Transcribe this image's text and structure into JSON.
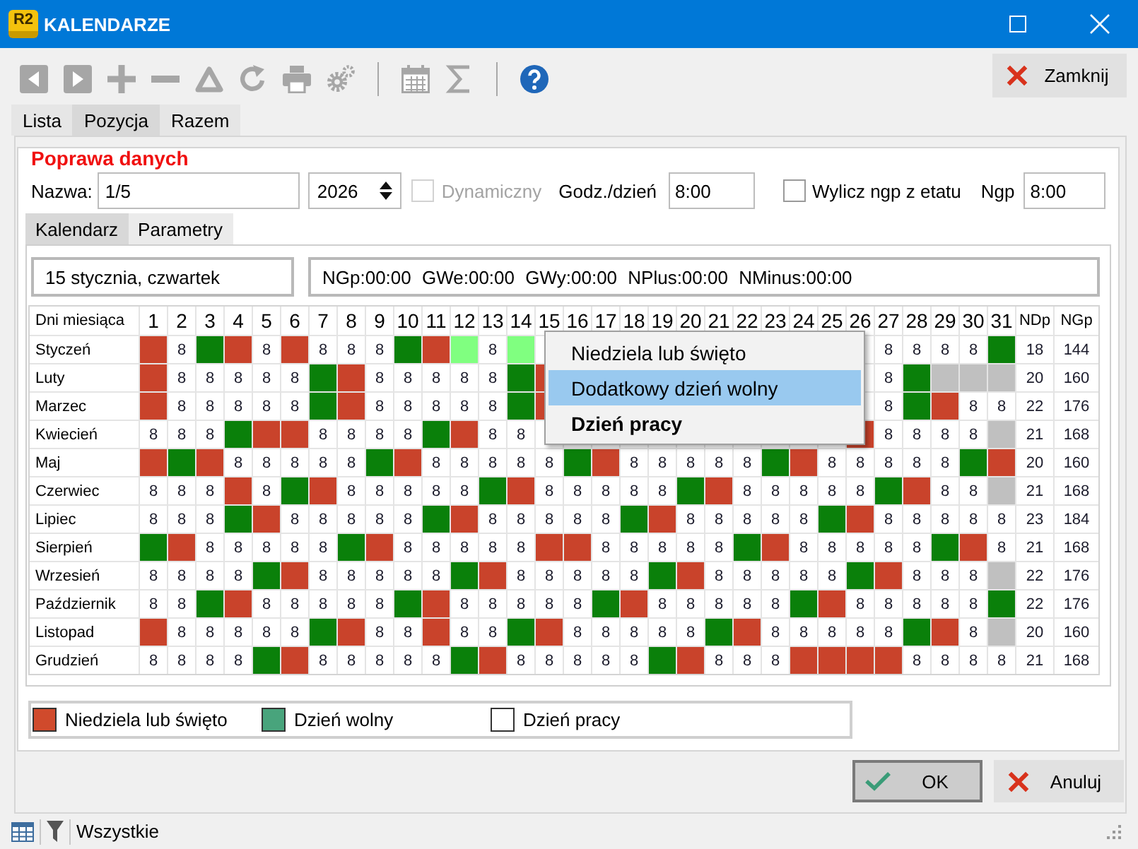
{
  "window": {
    "logo": "R2",
    "title": "KALENDARZE"
  },
  "toolbar": [
    {
      "kind": "back",
      "disabled": true
    },
    {
      "kind": "forward",
      "disabled": true
    },
    {
      "kind": "add",
      "disabled": true
    },
    {
      "kind": "remove",
      "disabled": true
    },
    {
      "kind": "delta",
      "disabled": true
    },
    {
      "kind": "refresh",
      "disabled": true
    },
    {
      "kind": "print",
      "disabled": true
    },
    {
      "kind": "gears",
      "disabled": true
    },
    {
      "kind": "separator"
    },
    {
      "kind": "calendar",
      "disabled": true
    },
    {
      "kind": "sigma",
      "disabled": true
    },
    {
      "kind": "separator"
    },
    {
      "kind": "help",
      "disabled": false
    }
  ],
  "close_button": {
    "label": "Zamknij"
  },
  "tabs": [
    {
      "label": "Lista",
      "selected": false
    },
    {
      "label": "Pozycja",
      "selected": true
    },
    {
      "label": "Razem",
      "selected": false
    }
  ],
  "panel": {
    "title": "Poprawa danych",
    "name": {
      "label": "Nazwa:",
      "value": "1/5"
    },
    "year": {
      "value": "2026"
    },
    "dynamic": {
      "label": "Dynamiczny",
      "checked": false,
      "disabled": true
    },
    "hours_per_day": {
      "label": "Godz./dzień",
      "value": "8:00"
    },
    "compute_ngp": {
      "label": "Wylicz ngp z etatu",
      "checked": false,
      "disabled": false
    },
    "ngp": {
      "label": "Ngp",
      "value": "8:00"
    },
    "subtabs": [
      {
        "label": "Kalendarz",
        "selected": true
      },
      {
        "label": "Parametry",
        "selected": false
      }
    ],
    "date_info": "15 stycznia, czwartek",
    "summary": "NGp:00:00 GWe:00:00 GWy:00:00 NPlus:00:00 NMinus:00:00",
    "calendar": {
      "corner": "Dni miesiąca",
      "columns": [
        "1",
        "2",
        "3",
        "4",
        "5",
        "6",
        "7",
        "8",
        "9",
        "10",
        "11",
        "12",
        "13",
        "14",
        "15",
        "16",
        "17",
        "18",
        "19",
        "20",
        "21",
        "22",
        "23",
        "24",
        "25",
        "26",
        "27",
        "28",
        "29",
        "30",
        "31",
        "NDp",
        "NGp"
      ],
      "rows": [
        {
          "month": "Styczeń",
          "cells": [
            {
              "kind": "holiday"
            },
            {
              "kind": "work",
              "text": "8"
            },
            {
              "kind": "free"
            },
            {
              "kind": "holiday"
            },
            {
              "kind": "work",
              "text": "8"
            },
            {
              "kind": "holiday"
            },
            {
              "kind": "work",
              "text": "8"
            },
            {
              "kind": "work",
              "text": "8"
            },
            {
              "kind": "work",
              "text": "8"
            },
            {
              "kind": "free"
            },
            {
              "kind": "holiday"
            },
            {
              "kind": "extra"
            },
            {
              "kind": "work",
              "text": "8"
            },
            {
              "kind": "extra"
            },
            {
              "kind": "work"
            },
            {
              "kind": "covered"
            },
            {
              "kind": "covered"
            },
            {
              "kind": "covered"
            },
            {
              "kind": "covered"
            },
            {
              "kind": "covered"
            },
            {
              "kind": "covered"
            },
            {
              "kind": "covered"
            },
            {
              "kind": "covered"
            },
            {
              "kind": "covered"
            },
            {
              "kind": "covered"
            },
            {
              "kind": "work"
            },
            {
              "kind": "work",
              "text": "8"
            },
            {
              "kind": "work",
              "text": "8"
            },
            {
              "kind": "work",
              "text": "8"
            },
            {
              "kind": "work",
              "text": "8"
            },
            {
              "kind": "free"
            },
            {
              "kind": "total",
              "text": "18"
            },
            {
              "kind": "total",
              "text": "144"
            }
          ]
        },
        {
          "month": "Luty",
          "cells": [
            {
              "kind": "holiday"
            },
            {
              "kind": "work",
              "text": "8"
            },
            {
              "kind": "work",
              "text": "8"
            },
            {
              "kind": "work",
              "text": "8"
            },
            {
              "kind": "work",
              "text": "8"
            },
            {
              "kind": "work",
              "text": "8"
            },
            {
              "kind": "free"
            },
            {
              "kind": "holiday"
            },
            {
              "kind": "work",
              "text": "8"
            },
            {
              "kind": "work",
              "text": "8"
            },
            {
              "kind": "work",
              "text": "8"
            },
            {
              "kind": "work",
              "text": "8"
            },
            {
              "kind": "work",
              "text": "8"
            },
            {
              "kind": "free"
            },
            {
              "kind": "holiday"
            },
            {
              "kind": "covered"
            },
            {
              "kind": "covered"
            },
            {
              "kind": "covered"
            },
            {
              "kind": "covered"
            },
            {
              "kind": "covered"
            },
            {
              "kind": "covered"
            },
            {
              "kind": "covered"
            },
            {
              "kind": "covered"
            },
            {
              "kind": "covered"
            },
            {
              "kind": "covered"
            },
            {
              "kind": "work"
            },
            {
              "kind": "work",
              "text": "8"
            },
            {
              "kind": "free"
            },
            {
              "kind": "empty"
            },
            {
              "kind": "empty"
            },
            {
              "kind": "empty"
            },
            {
              "kind": "total",
              "text": "20"
            },
            {
              "kind": "total",
              "text": "160"
            }
          ]
        },
        {
          "month": "Marzec",
          "cells": [
            {
              "kind": "holiday"
            },
            {
              "kind": "work",
              "text": "8"
            },
            {
              "kind": "work",
              "text": "8"
            },
            {
              "kind": "work",
              "text": "8"
            },
            {
              "kind": "work",
              "text": "8"
            },
            {
              "kind": "work",
              "text": "8"
            },
            {
              "kind": "free"
            },
            {
              "kind": "holiday"
            },
            {
              "kind": "work",
              "text": "8"
            },
            {
              "kind": "work",
              "text": "8"
            },
            {
              "kind": "work",
              "text": "8"
            },
            {
              "kind": "work",
              "text": "8"
            },
            {
              "kind": "work",
              "text": "8"
            },
            {
              "kind": "free"
            },
            {
              "kind": "holiday"
            },
            {
              "kind": "covered"
            },
            {
              "kind": "covered"
            },
            {
              "kind": "covered"
            },
            {
              "kind": "covered"
            },
            {
              "kind": "covered"
            },
            {
              "kind": "covered"
            },
            {
              "kind": "covered"
            },
            {
              "kind": "covered"
            },
            {
              "kind": "covered"
            },
            {
              "kind": "covered"
            },
            {
              "kind": "work"
            },
            {
              "kind": "work",
              "text": "8"
            },
            {
              "kind": "free"
            },
            {
              "kind": "holiday"
            },
            {
              "kind": "work",
              "text": "8"
            },
            {
              "kind": "work",
              "text": "8"
            },
            {
              "kind": "total",
              "text": "22"
            },
            {
              "kind": "total",
              "text": "176"
            }
          ]
        },
        {
          "month": "Kwiecień",
          "cells": [
            {
              "kind": "work",
              "text": "8"
            },
            {
              "kind": "work",
              "text": "8"
            },
            {
              "kind": "work",
              "text": "8"
            },
            {
              "kind": "free"
            },
            {
              "kind": "holiday"
            },
            {
              "kind": "holiday"
            },
            {
              "kind": "work",
              "text": "8"
            },
            {
              "kind": "work",
              "text": "8"
            },
            {
              "kind": "work",
              "text": "8"
            },
            {
              "kind": "work",
              "text": "8"
            },
            {
              "kind": "free"
            },
            {
              "kind": "holiday"
            },
            {
              "kind": "work",
              "text": "8"
            },
            {
              "kind": "work",
              "text": "8"
            },
            {
              "kind": "work"
            },
            {
              "kind": "covered"
            },
            {
              "kind": "covered"
            },
            {
              "kind": "covered"
            },
            {
              "kind": "covered"
            },
            {
              "kind": "covered"
            },
            {
              "kind": "covered"
            },
            {
              "kind": "covered"
            },
            {
              "kind": "covered"
            },
            {
              "kind": "covered"
            },
            {
              "kind": "covered"
            },
            {
              "kind": "holiday"
            },
            {
              "kind": "work",
              "text": "8"
            },
            {
              "kind": "work",
              "text": "8"
            },
            {
              "kind": "work",
              "text": "8"
            },
            {
              "kind": "work",
              "text": "8"
            },
            {
              "kind": "empty"
            },
            {
              "kind": "total",
              "text": "21"
            },
            {
              "kind": "total",
              "text": "168"
            }
          ]
        },
        {
          "month": "Maj",
          "cells": [
            {
              "kind": "holiday"
            },
            {
              "kind": "free"
            },
            {
              "kind": "holiday"
            },
            {
              "kind": "work",
              "text": "8"
            },
            {
              "kind": "work",
              "text": "8"
            },
            {
              "kind": "work",
              "text": "8"
            },
            {
              "kind": "work",
              "text": "8"
            },
            {
              "kind": "work",
              "text": "8"
            },
            {
              "kind": "free"
            },
            {
              "kind": "holiday"
            },
            {
              "kind": "work",
              "text": "8"
            },
            {
              "kind": "work",
              "text": "8"
            },
            {
              "kind": "work",
              "text": "8"
            },
            {
              "kind": "work",
              "text": "8"
            },
            {
              "kind": "work",
              "text": "8"
            },
            {
              "kind": "free"
            },
            {
              "kind": "holiday"
            },
            {
              "kind": "work",
              "text": "8"
            },
            {
              "kind": "work",
              "text": "8"
            },
            {
              "kind": "work",
              "text": "8"
            },
            {
              "kind": "work",
              "text": "8"
            },
            {
              "kind": "work",
              "text": "8"
            },
            {
              "kind": "free"
            },
            {
              "kind": "holiday"
            },
            {
              "kind": "work",
              "text": "8"
            },
            {
              "kind": "work",
              "text": "8"
            },
            {
              "kind": "work",
              "text": "8"
            },
            {
              "kind": "work",
              "text": "8"
            },
            {
              "kind": "work",
              "text": "8"
            },
            {
              "kind": "free"
            },
            {
              "kind": "holiday"
            },
            {
              "kind": "total",
              "text": "20"
            },
            {
              "kind": "total",
              "text": "160"
            }
          ]
        },
        {
          "month": "Czerwiec",
          "cells": [
            {
              "kind": "work",
              "text": "8"
            },
            {
              "kind": "work",
              "text": "8"
            },
            {
              "kind": "work",
              "text": "8"
            },
            {
              "kind": "holiday"
            },
            {
              "kind": "work",
              "text": "8"
            },
            {
              "kind": "free"
            },
            {
              "kind": "holiday"
            },
            {
              "kind": "work",
              "text": "8"
            },
            {
              "kind": "work",
              "text": "8"
            },
            {
              "kind": "work",
              "text": "8"
            },
            {
              "kind": "work",
              "text": "8"
            },
            {
              "kind": "work",
              "text": "8"
            },
            {
              "kind": "free"
            },
            {
              "kind": "holiday"
            },
            {
              "kind": "work",
              "text": "8"
            },
            {
              "kind": "work",
              "text": "8"
            },
            {
              "kind": "work",
              "text": "8"
            },
            {
              "kind": "work",
              "text": "8"
            },
            {
              "kind": "work",
              "text": "8"
            },
            {
              "kind": "free"
            },
            {
              "kind": "holiday"
            },
            {
              "kind": "work",
              "text": "8"
            },
            {
              "kind": "work",
              "text": "8"
            },
            {
              "kind": "work",
              "text": "8"
            },
            {
              "kind": "work",
              "text": "8"
            },
            {
              "kind": "work",
              "text": "8"
            },
            {
              "kind": "free"
            },
            {
              "kind": "holiday"
            },
            {
              "kind": "work",
              "text": "8"
            },
            {
              "kind": "work",
              "text": "8"
            },
            {
              "kind": "empty"
            },
            {
              "kind": "total",
              "text": "21"
            },
            {
              "kind": "total",
              "text": "168"
            }
          ]
        },
        {
          "month": "Lipiec",
          "cells": [
            {
              "kind": "work",
              "text": "8"
            },
            {
              "kind": "work",
              "text": "8"
            },
            {
              "kind": "work",
              "text": "8"
            },
            {
              "kind": "free"
            },
            {
              "kind": "holiday"
            },
            {
              "kind": "work",
              "text": "8"
            },
            {
              "kind": "work",
              "text": "8"
            },
            {
              "kind": "work",
              "text": "8"
            },
            {
              "kind": "work",
              "text": "8"
            },
            {
              "kind": "work",
              "text": "8"
            },
            {
              "kind": "free"
            },
            {
              "kind": "holiday"
            },
            {
              "kind": "work",
              "text": "8"
            },
            {
              "kind": "work",
              "text": "8"
            },
            {
              "kind": "work",
              "text": "8"
            },
            {
              "kind": "work",
              "text": "8"
            },
            {
              "kind": "work",
              "text": "8"
            },
            {
              "kind": "free"
            },
            {
              "kind": "holiday"
            },
            {
              "kind": "work",
              "text": "8"
            },
            {
              "kind": "work",
              "text": "8"
            },
            {
              "kind": "work",
              "text": "8"
            },
            {
              "kind": "work",
              "text": "8"
            },
            {
              "kind": "work",
              "text": "8"
            },
            {
              "kind": "free"
            },
            {
              "kind": "holiday"
            },
            {
              "kind": "work",
              "text": "8"
            },
            {
              "kind": "work",
              "text": "8"
            },
            {
              "kind": "work",
              "text": "8"
            },
            {
              "kind": "work",
              "text": "8"
            },
            {
              "kind": "work",
              "text": "8"
            },
            {
              "kind": "total",
              "text": "23"
            },
            {
              "kind": "total",
              "text": "184"
            }
          ]
        },
        {
          "month": "Sierpień",
          "cells": [
            {
              "kind": "free"
            },
            {
              "kind": "holiday"
            },
            {
              "kind": "work",
              "text": "8"
            },
            {
              "kind": "work",
              "text": "8"
            },
            {
              "kind": "work",
              "text": "8"
            },
            {
              "kind": "work",
              "text": "8"
            },
            {
              "kind": "work",
              "text": "8"
            },
            {
              "kind": "free"
            },
            {
              "kind": "holiday"
            },
            {
              "kind": "work",
              "text": "8"
            },
            {
              "kind": "work",
              "text": "8"
            },
            {
              "kind": "work",
              "text": "8"
            },
            {
              "kind": "work",
              "text": "8"
            },
            {
              "kind": "work",
              "text": "8"
            },
            {
              "kind": "holiday"
            },
            {
              "kind": "holiday"
            },
            {
              "kind": "work",
              "text": "8"
            },
            {
              "kind": "work",
              "text": "8"
            },
            {
              "kind": "work",
              "text": "8"
            },
            {
              "kind": "work",
              "text": "8"
            },
            {
              "kind": "work",
              "text": "8"
            },
            {
              "kind": "free"
            },
            {
              "kind": "holiday"
            },
            {
              "kind": "work",
              "text": "8"
            },
            {
              "kind": "work",
              "text": "8"
            },
            {
              "kind": "work",
              "text": "8"
            },
            {
              "kind": "work",
              "text": "8"
            },
            {
              "kind": "work",
              "text": "8"
            },
            {
              "kind": "free"
            },
            {
              "kind": "holiday"
            },
            {
              "kind": "work",
              "text": "8"
            },
            {
              "kind": "total",
              "text": "21"
            },
            {
              "kind": "total",
              "text": "168"
            }
          ]
        },
        {
          "month": "Wrzesień",
          "cells": [
            {
              "kind": "work",
              "text": "8"
            },
            {
              "kind": "work",
              "text": "8"
            },
            {
              "kind": "work",
              "text": "8"
            },
            {
              "kind": "work",
              "text": "8"
            },
            {
              "kind": "free"
            },
            {
              "kind": "holiday"
            },
            {
              "kind": "work",
              "text": "8"
            },
            {
              "kind": "work",
              "text": "8"
            },
            {
              "kind": "work",
              "text": "8"
            },
            {
              "kind": "work",
              "text": "8"
            },
            {
              "kind": "work",
              "text": "8"
            },
            {
              "kind": "free"
            },
            {
              "kind": "holiday"
            },
            {
              "kind": "work",
              "text": "8"
            },
            {
              "kind": "work",
              "text": "8"
            },
            {
              "kind": "work",
              "text": "8"
            },
            {
              "kind": "work",
              "text": "8"
            },
            {
              "kind": "work",
              "text": "8"
            },
            {
              "kind": "free"
            },
            {
              "kind": "holiday"
            },
            {
              "kind": "work",
              "text": "8"
            },
            {
              "kind": "work",
              "text": "8"
            },
            {
              "kind": "work",
              "text": "8"
            },
            {
              "kind": "work",
              "text": "8"
            },
            {
              "kind": "work",
              "text": "8"
            },
            {
              "kind": "free"
            },
            {
              "kind": "holiday"
            },
            {
              "kind": "work",
              "text": "8"
            },
            {
              "kind": "work",
              "text": "8"
            },
            {
              "kind": "work",
              "text": "8"
            },
            {
              "kind": "empty"
            },
            {
              "kind": "total",
              "text": "22"
            },
            {
              "kind": "total",
              "text": "176"
            }
          ]
        },
        {
          "month": "Październik",
          "cells": [
            {
              "kind": "work",
              "text": "8"
            },
            {
              "kind": "work",
              "text": "8"
            },
            {
              "kind": "free"
            },
            {
              "kind": "holiday"
            },
            {
              "kind": "work",
              "text": "8"
            },
            {
              "kind": "work",
              "text": "8"
            },
            {
              "kind": "work",
              "text": "8"
            },
            {
              "kind": "work",
              "text": "8"
            },
            {
              "kind": "work",
              "text": "8"
            },
            {
              "kind": "free"
            },
            {
              "kind": "holiday"
            },
            {
              "kind": "work",
              "text": "8"
            },
            {
              "kind": "work",
              "text": "8"
            },
            {
              "kind": "work",
              "text": "8"
            },
            {
              "kind": "work",
              "text": "8"
            },
            {
              "kind": "work",
              "text": "8"
            },
            {
              "kind": "free"
            },
            {
              "kind": "holiday"
            },
            {
              "kind": "work",
              "text": "8"
            },
            {
              "kind": "work",
              "text": "8"
            },
            {
              "kind": "work",
              "text": "8"
            },
            {
              "kind": "work",
              "text": "8"
            },
            {
              "kind": "work",
              "text": "8"
            },
            {
              "kind": "free"
            },
            {
              "kind": "holiday"
            },
            {
              "kind": "work",
              "text": "8"
            },
            {
              "kind": "work",
              "text": "8"
            },
            {
              "kind": "work",
              "text": "8"
            },
            {
              "kind": "work",
              "text": "8"
            },
            {
              "kind": "work",
              "text": "8"
            },
            {
              "kind": "free"
            },
            {
              "kind": "total",
              "text": "22"
            },
            {
              "kind": "total",
              "text": "176"
            }
          ]
        },
        {
          "month": "Listopad",
          "cells": [
            {
              "kind": "holiday"
            },
            {
              "kind": "work",
              "text": "8"
            },
            {
              "kind": "work",
              "text": "8"
            },
            {
              "kind": "work",
              "text": "8"
            },
            {
              "kind": "work",
              "text": "8"
            },
            {
              "kind": "work",
              "text": "8"
            },
            {
              "kind": "free"
            },
            {
              "kind": "holiday"
            },
            {
              "kind": "work",
              "text": "8"
            },
            {
              "kind": "work",
              "text": "8"
            },
            {
              "kind": "holiday"
            },
            {
              "kind": "work",
              "text": "8"
            },
            {
              "kind": "work",
              "text": "8"
            },
            {
              "kind": "free"
            },
            {
              "kind": "holiday"
            },
            {
              "kind": "work",
              "text": "8"
            },
            {
              "kind": "work",
              "text": "8"
            },
            {
              "kind": "work",
              "text": "8"
            },
            {
              "kind": "work",
              "text": "8"
            },
            {
              "kind": "work",
              "text": "8"
            },
            {
              "kind": "free"
            },
            {
              "kind": "holiday"
            },
            {
              "kind": "work",
              "text": "8"
            },
            {
              "kind": "work",
              "text": "8"
            },
            {
              "kind": "work",
              "text": "8"
            },
            {
              "kind": "work",
              "text": "8"
            },
            {
              "kind": "work",
              "text": "8"
            },
            {
              "kind": "free"
            },
            {
              "kind": "holiday"
            },
            {
              "kind": "work",
              "text": "8"
            },
            {
              "kind": "empty"
            },
            {
              "kind": "total",
              "text": "20"
            },
            {
              "kind": "total",
              "text": "160"
            }
          ]
        },
        {
          "month": "Grudzień",
          "cells": [
            {
              "kind": "work",
              "text": "8"
            },
            {
              "kind": "work",
              "text": "8"
            },
            {
              "kind": "work",
              "text": "8"
            },
            {
              "kind": "work",
              "text": "8"
            },
            {
              "kind": "free"
            },
            {
              "kind": "holiday"
            },
            {
              "kind": "work",
              "text": "8"
            },
            {
              "kind": "work",
              "text": "8"
            },
            {
              "kind": "work",
              "text": "8"
            },
            {
              "kind": "work",
              "text": "8"
            },
            {
              "kind": "work",
              "text": "8"
            },
            {
              "kind": "free"
            },
            {
              "kind": "holiday"
            },
            {
              "kind": "work",
              "text": "8"
            },
            {
              "kind": "work",
              "text": "8"
            },
            {
              "kind": "work",
              "text": "8"
            },
            {
              "kind": "work",
              "text": "8"
            },
            {
              "kind": "work",
              "text": "8"
            },
            {
              "kind": "free"
            },
            {
              "kind": "holiday"
            },
            {
              "kind": "work",
              "text": "8"
            },
            {
              "kind": "work",
              "text": "8"
            },
            {
              "kind": "work",
              "text": "8"
            },
            {
              "kind": "holiday"
            },
            {
              "kind": "holiday"
            },
            {
              "kind": "holiday"
            },
            {
              "kind": "holiday"
            },
            {
              "kind": "work",
              "text": "8"
            },
            {
              "kind": "work",
              "text": "8"
            },
            {
              "kind": "work",
              "text": "8"
            },
            {
              "kind": "work",
              "text": "8"
            },
            {
              "kind": "total",
              "text": "21"
            },
            {
              "kind": "total",
              "text": "168"
            }
          ]
        }
      ]
    },
    "context_menu": {
      "items": [
        {
          "label": "Niedziela lub święto",
          "selected": false,
          "default": false
        },
        {
          "label": "Dodatkowy dzień wolny",
          "selected": true,
          "default": false
        },
        {
          "label": "Dzień pracy",
          "selected": false,
          "default": true
        }
      ]
    },
    "legend": [
      {
        "label": "Niedziela lub święto",
        "color": "#d04a2c"
      },
      {
        "label": "Dzień wolny",
        "color": "#48a47c"
      },
      {
        "label": "Dzień pracy",
        "color": "#ffffff"
      }
    ]
  },
  "buttons": [
    {
      "kind": "ok",
      "label": "OK",
      "default": true
    },
    {
      "kind": "cancel",
      "label": "Anuluj",
      "default": false
    }
  ],
  "status_bar": {
    "filter": "Wszystkie"
  }
}
